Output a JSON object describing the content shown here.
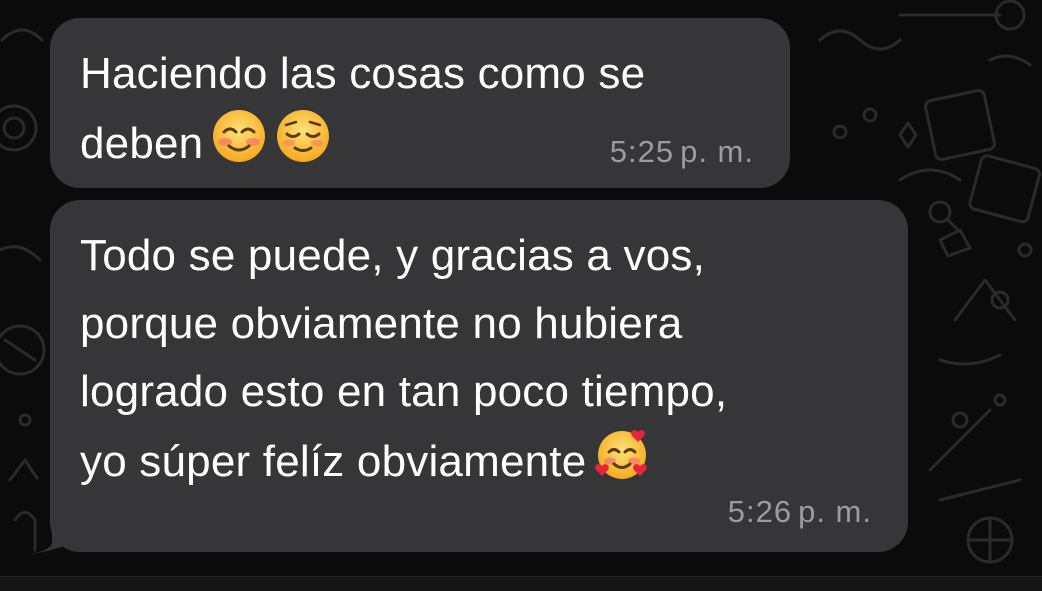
{
  "messages": [
    {
      "lines": [
        "Haciendo las cosas como se",
        "deben"
      ],
      "emojis": [
        "smiling-blush-emoji",
        "relieved-face-emoji"
      ],
      "time": "5:25",
      "ampm": "p. m."
    },
    {
      "lines": [
        "Todo se puede, y gracias a vos,",
        "porque obviamente no hubiera",
        "logrado esto en tan poco tiempo,",
        "yo súper felíz obviamente"
      ],
      "emojis": [
        "smiling-face-with-hearts-emoji"
      ],
      "time": "5:26",
      "ampm": "p. m."
    }
  ],
  "colors": {
    "background": "#0b0b0b",
    "bubble": "#363638",
    "text": "#ffffff",
    "timestamp": "#9c9ca0"
  }
}
